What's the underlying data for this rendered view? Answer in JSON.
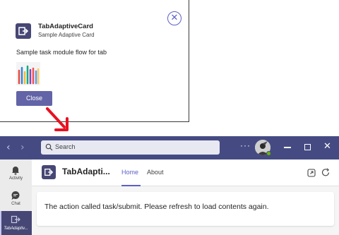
{
  "dialog": {
    "app_name": "TabAdaptiveCard",
    "subtitle": "Sample Adaptive Card",
    "body_text": "Sample task module flow for tab",
    "button_label": "Close",
    "close_icon": "circle-x-icon"
  },
  "titlebar": {
    "search_placeholder": "Search",
    "more_label": "···",
    "icons": [
      "chevron-left-icon",
      "chevron-right-icon",
      "search-icon",
      "minimize-icon",
      "maximize-icon",
      "close-icon"
    ]
  },
  "rail": {
    "items": [
      {
        "label": "Activity",
        "icon": "bell-icon"
      },
      {
        "label": "Chat",
        "icon": "chat-icon"
      },
      {
        "label": "TabAdaptiv...",
        "icon": "app-icon"
      }
    ]
  },
  "tab": {
    "title": "TabAdapti...",
    "tabs": [
      {
        "label": "Home",
        "active": true
      },
      {
        "label": "About",
        "active": false
      }
    ]
  },
  "content": {
    "message": "The action called task/submit. Please refresh to load contents again."
  },
  "colors": {
    "titlebar": "#454b82",
    "accent": "#5b5fc7",
    "button": "#6264a7",
    "arrow": "#e81123"
  }
}
